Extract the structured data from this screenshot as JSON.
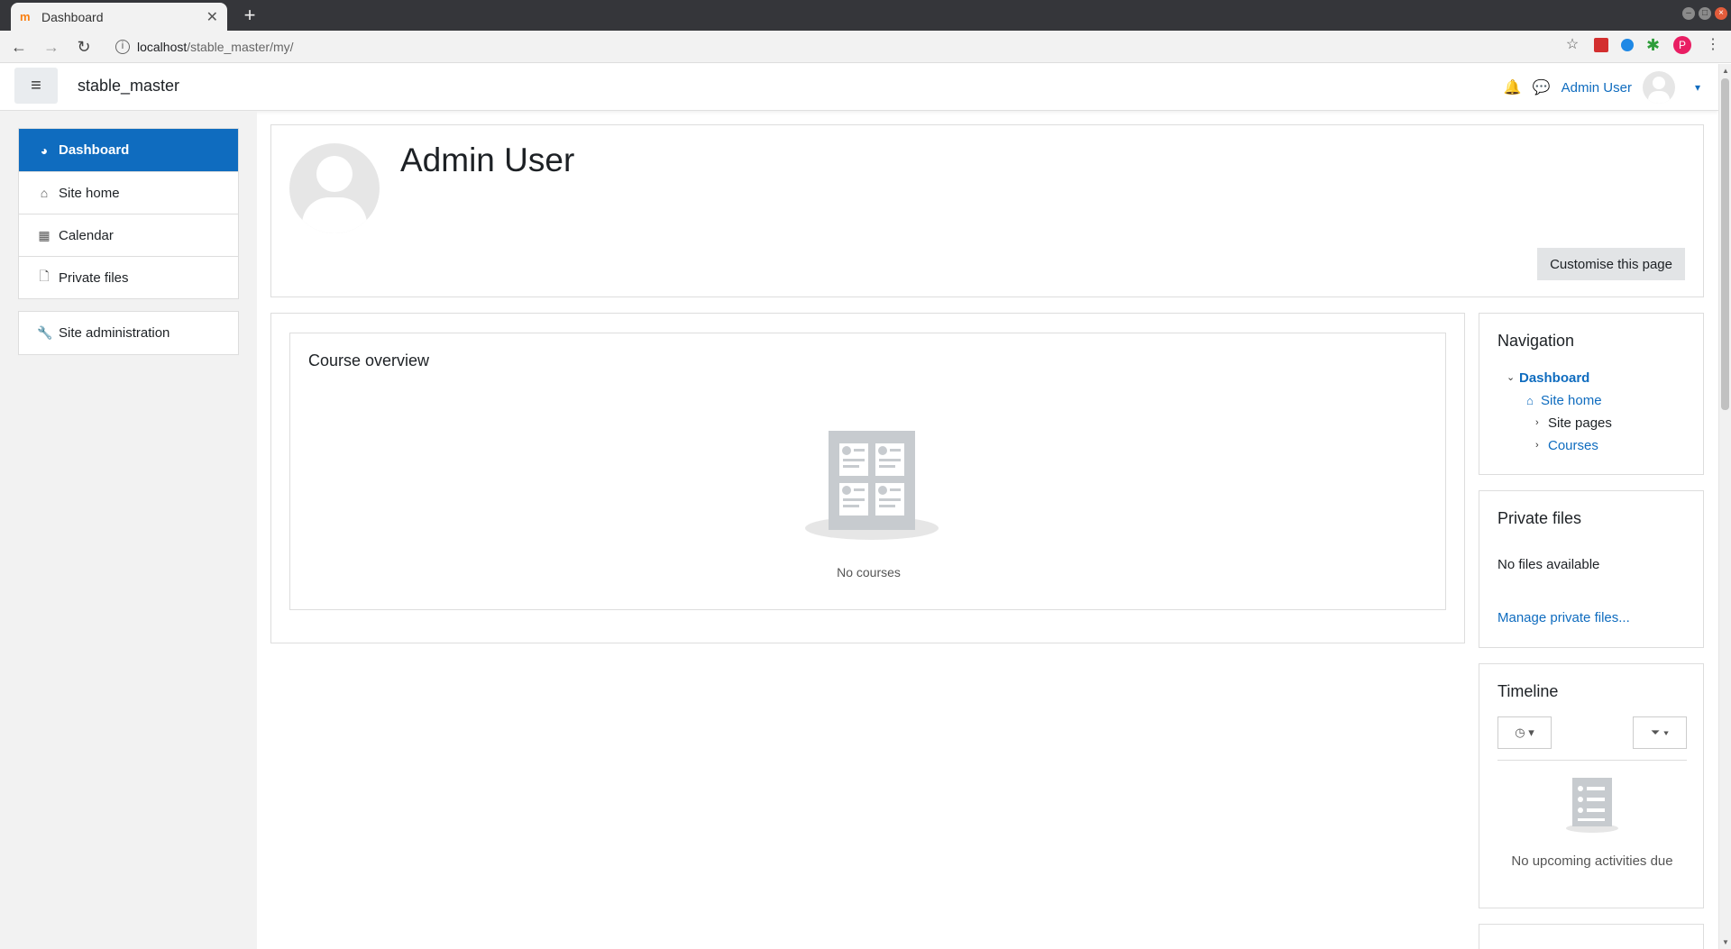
{
  "browser": {
    "tab_title": "Dashboard",
    "tab_close": "✕",
    "new_tab": "+",
    "url_host": "localhost",
    "url_path": "/stable_master/my/"
  },
  "navbar": {
    "site_name": "stable_master",
    "user_name": "Admin User",
    "hamburger_icon": "≡",
    "bell_icon": "🔔",
    "message_icon": "💬",
    "caret": "▾"
  },
  "drawer": {
    "items": [
      {
        "label": "Dashboard",
        "icon": "◕",
        "active": true
      },
      {
        "label": "Site home",
        "icon": "⌂"
      },
      {
        "label": "Calendar",
        "icon": "▦"
      },
      {
        "label": "Private files",
        "icon": "🗋"
      }
    ],
    "admin": {
      "label": "Site administration",
      "icon": "🔧"
    }
  },
  "header": {
    "title": "Admin User",
    "customise_label": "Customise this page"
  },
  "course_overview": {
    "title": "Course overview",
    "empty_text": "No courses"
  },
  "navigation_block": {
    "title": "Navigation",
    "dashboard": "Dashboard",
    "site_home": "Site home",
    "site_pages": "Site pages",
    "courses": "Courses"
  },
  "private_files_block": {
    "title": "Private files",
    "empty_text": "No files available",
    "manage_link": "Manage private files..."
  },
  "timeline_block": {
    "title": "Timeline",
    "empty_text": "No upcoming activities due"
  },
  "colors": {
    "accent": "#0f6cbf",
    "drawer_bg": "#f2f2f2"
  }
}
